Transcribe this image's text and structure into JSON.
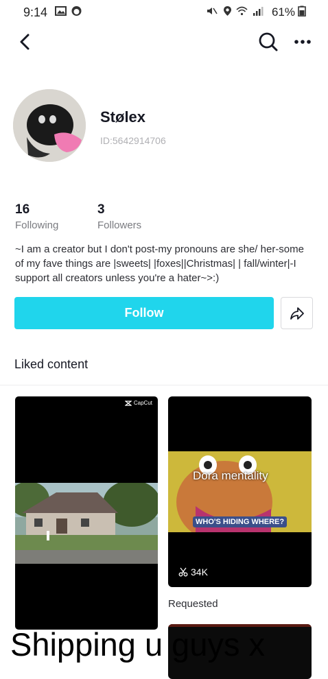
{
  "status_bar": {
    "time": "9:14",
    "battery": "61%"
  },
  "nav": {
    "back_icon": "chevron-left-icon",
    "search_icon": "search-icon",
    "more_icon": "more-dots-icon"
  },
  "profile": {
    "name": "Stølex",
    "id": "ID:5642914706",
    "following_count": "16",
    "following_label": "Following",
    "followers_count": "3",
    "followers_label": "Followers",
    "bio": "~I am a creator but I don't post-my pronouns are she/ her-some of my fave things are |sweets| |foxes||Christmas| | fall/winter|-I support all creators unless you're a hater~>:)",
    "follow_label": "Follow"
  },
  "liked": {
    "title": "Liked content",
    "videos": [
      {
        "watermark": "CapCut"
      },
      {
        "overlay_title": "Dora mentality",
        "overlay_subtitle": "WHO'S HIDING WHERE?",
        "views": "34K",
        "status": "Requested"
      }
    ]
  },
  "caption": "Shipping u guys x",
  "colors": {
    "accent": "#20d5ec",
    "text": "#161823",
    "muted": "#7a7b80"
  }
}
